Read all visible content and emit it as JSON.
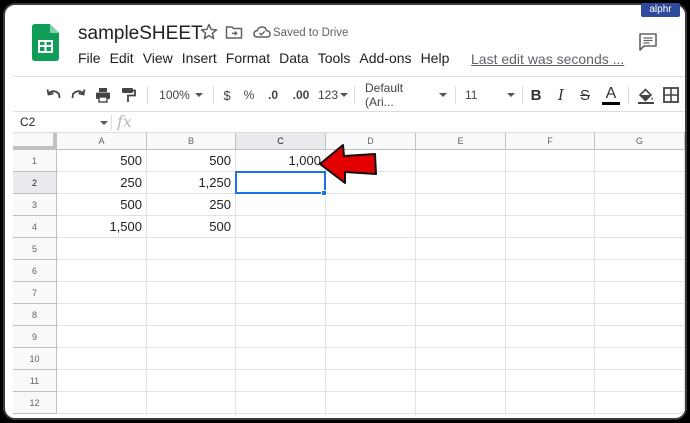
{
  "header": {
    "title": "sampleSHEET",
    "saved_status": "Saved to Drive",
    "last_edit": "Last edit was seconds ...",
    "menu": [
      "File",
      "Edit",
      "View",
      "Insert",
      "Format",
      "Data",
      "Tools",
      "Add-ons",
      "Help"
    ]
  },
  "toolbar": {
    "zoom": "100%",
    "currency": "$",
    "percent": "%",
    "decrease_decimal": ".0",
    "increase_decimal": ".00",
    "more_formats": "123",
    "font": "Default (Ari...",
    "font_size": "11",
    "bold": "B",
    "italic": "I",
    "strikethrough": "S",
    "text_color": "A"
  },
  "formula_bar": {
    "cell_ref": "C2",
    "fx": "fx",
    "value": ""
  },
  "grid": {
    "columns": [
      "A",
      "B",
      "C",
      "D",
      "E",
      "F",
      "G"
    ],
    "rows": [
      "1",
      "2",
      "3",
      "4",
      "5",
      "6",
      "7",
      "8",
      "9",
      "10",
      "11",
      "12"
    ],
    "cells": {
      "r1": [
        "500",
        "500",
        "1,000"
      ],
      "r2": [
        "250",
        "1,250",
        ""
      ],
      "r3": [
        "500",
        "250",
        ""
      ],
      "r4": [
        "1,500",
        "500",
        ""
      ]
    },
    "selected_cell": "C2"
  },
  "colors": {
    "accent": "#1a73e8",
    "sheets_green": "#0f9d58",
    "arrow_red": "#e50000"
  },
  "watermark": "alphr"
}
